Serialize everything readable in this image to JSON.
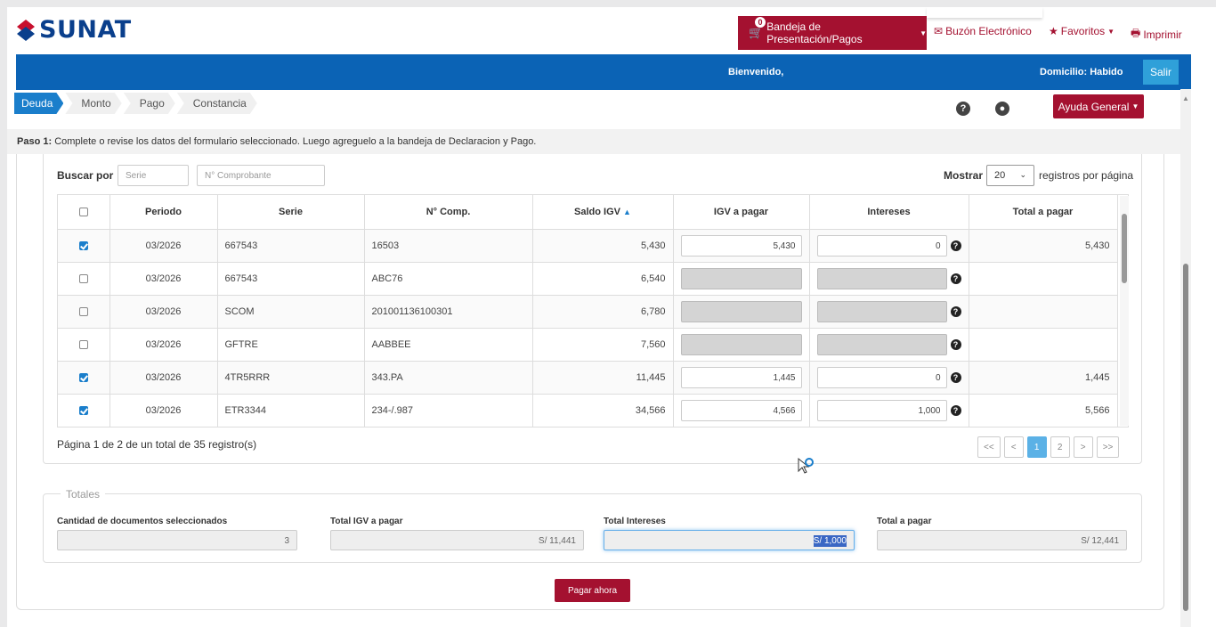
{
  "header": {
    "logo_text": "SUNAT",
    "bandeja_label": "Bandeja de Presentación/Pagos",
    "bandeja_count": "0",
    "buzon_label": "Buzón Electrónico",
    "favoritos_label": "Favoritos",
    "imprimir_label": "Imprimir"
  },
  "bluebar": {
    "welcome": "Bienvenido,",
    "domicilio": "Domicilio: Habido",
    "salir": "Salir"
  },
  "steps": [
    "Deuda",
    "Monto",
    "Pago",
    "Constancia"
  ],
  "ayuda_label": "Ayuda General",
  "step_message": {
    "prefix": "Paso 1:",
    "text": " Complete o revise los datos del formulario seleccionado. Luego agreguelo a la bandeja de Declaracion y Pago."
  },
  "search": {
    "label": "Buscar por",
    "serie_placeholder": "Serie",
    "comprobante_placeholder": "N° Comprobante",
    "mostrar_label": "Mostrar",
    "mostrar_value": "20",
    "registros_label": "registros por página"
  },
  "table": {
    "headers": [
      "",
      "Periodo",
      "Serie",
      "N° Comp.",
      "Saldo IGV",
      "IGV a pagar",
      "Intereses",
      "Total a pagar"
    ],
    "rows": [
      {
        "checked": true,
        "periodo": "03/2026",
        "serie": "667543",
        "comp": "16503",
        "saldo": "5,430",
        "igv": "5,430",
        "intereses": "0",
        "total": "5,430",
        "enabled": true
      },
      {
        "checked": false,
        "periodo": "03/2026",
        "serie": "667543",
        "comp": "ABC76",
        "saldo": "6,540",
        "igv": "",
        "intereses": "",
        "total": "",
        "enabled": false
      },
      {
        "checked": false,
        "periodo": "03/2026",
        "serie": "SCOM",
        "comp": "201001136100301",
        "saldo": "6,780",
        "igv": "",
        "intereses": "",
        "total": "",
        "enabled": false
      },
      {
        "checked": false,
        "periodo": "03/2026",
        "serie": "GFTRE",
        "comp": "AABBEE",
        "saldo": "7,560",
        "igv": "",
        "intereses": "",
        "total": "",
        "enabled": false
      },
      {
        "checked": true,
        "periodo": "03/2026",
        "serie": "4TR5RRR",
        "comp": "343.PA",
        "saldo": "11,445",
        "igv": "1,445",
        "intereses": "0",
        "total": "1,445",
        "enabled": true
      },
      {
        "checked": true,
        "periodo": "03/2026",
        "serie": "ETR3344",
        "comp": "234-/.987",
        "saldo": "34,566",
        "igv": "4,566",
        "intereses": "1,000",
        "total": "5,566",
        "enabled": true
      }
    ]
  },
  "pagination": {
    "info": "Página 1 de 2 de un total de 35 registro(s)",
    "buttons": [
      "<<",
      "<",
      "1",
      "2",
      ">",
      ">>"
    ],
    "current": "1"
  },
  "totals": {
    "title": "Totales",
    "cantidad_label": "Cantidad de documentos seleccionados",
    "cantidad_value": "3",
    "igv_label": "Total IGV a pagar",
    "igv_value": "S/ 11,441",
    "intereses_label": "Total Intereses",
    "intereses_value": "S/ 1,000",
    "total_label": "Total a pagar",
    "total_value": "S/ 12,441"
  },
  "pagar_label": "Pagar ahora",
  "colors": {
    "brand_red": "#a41130",
    "brand_blue": "#0b63b5",
    "accent_blue": "#1a7ecb"
  }
}
